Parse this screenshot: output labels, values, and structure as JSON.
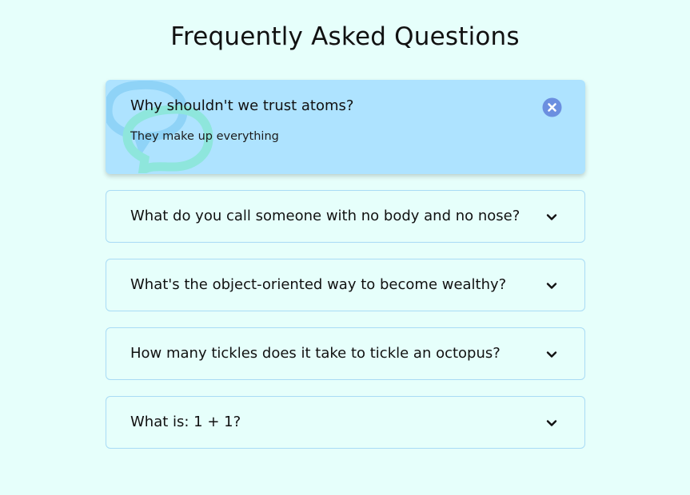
{
  "page": {
    "title": "Frequently Asked Questions"
  },
  "faqs": [
    {
      "question": "Why shouldn't we trust atoms?",
      "answer": "They make up everything",
      "state": "expanded",
      "toggle_icon": "close-icon"
    },
    {
      "question": "What do you call someone with no body and no nose?",
      "state": "collapsed",
      "toggle_icon": "chevron-down-icon"
    },
    {
      "question": "What's the object-oriented way to become wealthy?",
      "state": "collapsed",
      "toggle_icon": "chevron-down-icon"
    },
    {
      "question": "How many tickles does it take to tickle an octopus?",
      "state": "collapsed",
      "toggle_icon": "chevron-down-icon"
    },
    {
      "question": "What is: 1 + 1?",
      "state": "collapsed",
      "toggle_icon": "chevron-down-icon"
    }
  ],
  "colors": {
    "background": "#e6fffb",
    "active_card": "#aee3ff",
    "card_border": "#a9dbf5",
    "close_icon": "#6b8fe0",
    "decor_bubble_blue": "#8fd3f7",
    "decor_bubble_teal": "#8ee6dc"
  }
}
